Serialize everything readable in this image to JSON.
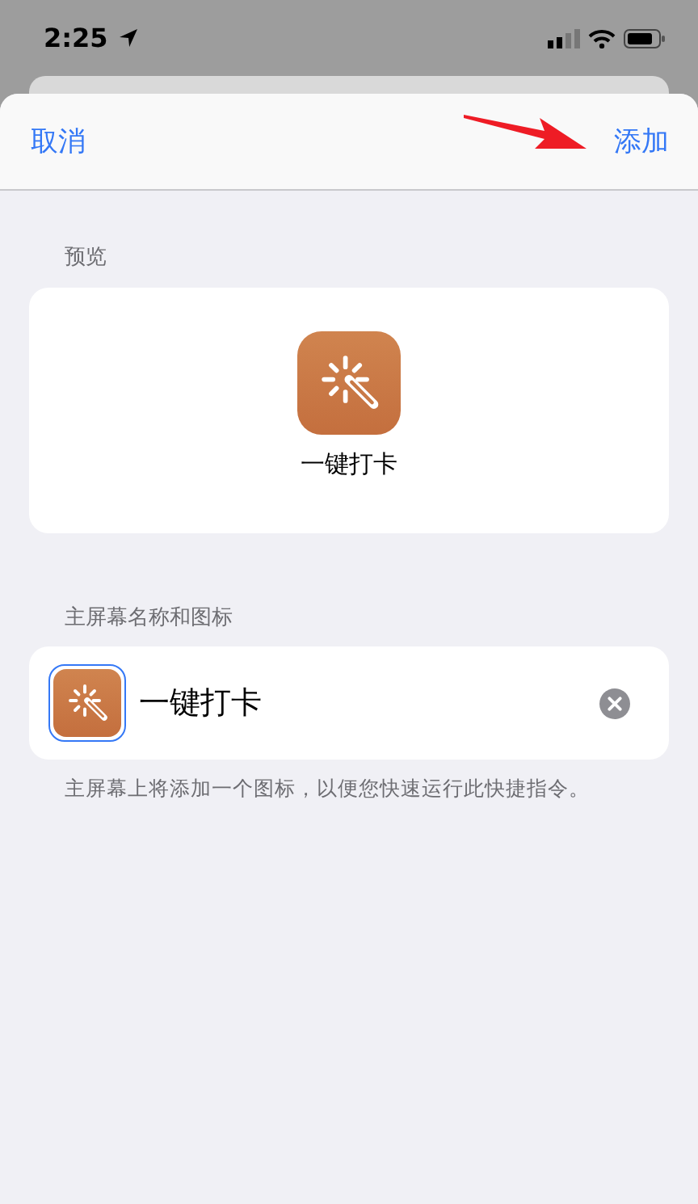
{
  "status_bar": {
    "time": "2:25"
  },
  "nav": {
    "cancel": "取消",
    "add": "添加"
  },
  "annotation": {
    "kind": "arrow"
  },
  "preview": {
    "header": "预览",
    "name": "一键打卡"
  },
  "home_screen": {
    "header": "主屏幕名称和图标",
    "name": "一键打卡",
    "icon_selected": true,
    "footer": "主屏幕上将添加一个图标，以便您快速运行此快捷指令。"
  }
}
